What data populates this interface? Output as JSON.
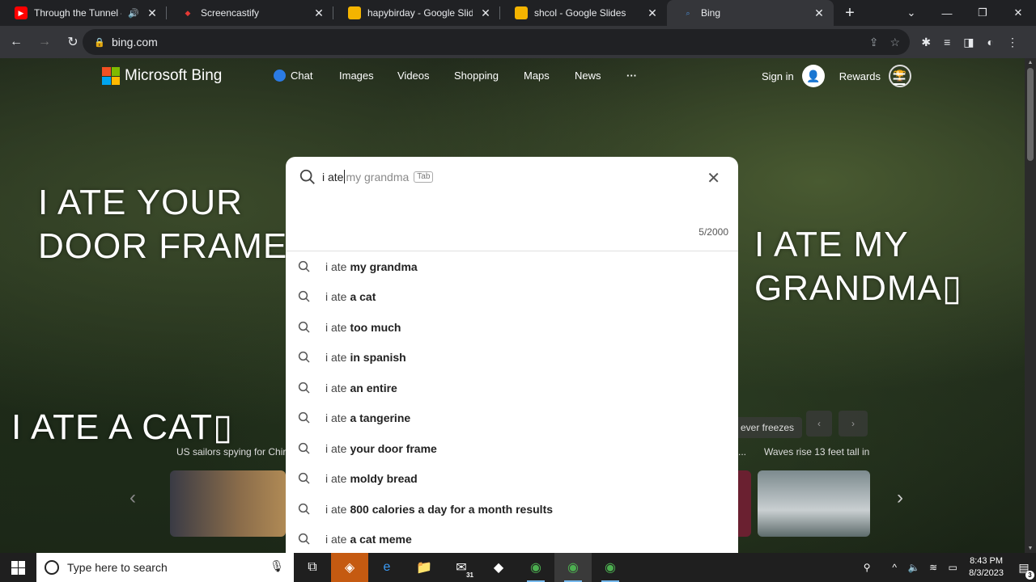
{
  "browser": {
    "tabs": [
      {
        "title": "Through the Tunnel – Ki",
        "favicon": "youtube-icon",
        "audio": true
      },
      {
        "title": "Screencastify",
        "favicon": "screencastify-icon"
      },
      {
        "title": "hapybirday - Google Slides",
        "favicon": "slides-icon"
      },
      {
        "title": "shcol - Google Slides",
        "favicon": "slides-icon"
      },
      {
        "title": "Bing",
        "favicon": "bing-icon",
        "active": true
      }
    ],
    "url": "bing.com"
  },
  "bing": {
    "brand": "Microsoft Bing",
    "nav": [
      "Chat",
      "Images",
      "Videos",
      "Shopping",
      "Maps",
      "News",
      "···"
    ],
    "sign_in": "Sign in",
    "rewards": "Rewards"
  },
  "overlay_text": {
    "left_top_1": "I ATE YOUR",
    "left_top_2": "DOOR FRAME▯",
    "right_1": "I ATE MY",
    "right_2": "GRANDMA▯",
    "left_bottom": "I ATE A CAT▯"
  },
  "news_strip": {
    "left_caption": "US sailors spying for Chir",
    "mid_caption": "ever freezes",
    "right_caption": "Waves rise 13 feet tall in",
    "dots": "..."
  },
  "search": {
    "typed": "i ate",
    "ghost": " my grandma",
    "tab_hint": "Tab",
    "count": "5/2000",
    "prefix": "i ate",
    "suggestions": [
      "my grandma",
      "a cat",
      "too much",
      "in spanish",
      "an entire",
      "a tangerine",
      "your door frame",
      "moldy bread",
      "800 calories a day for a month results",
      "a cat meme"
    ]
  },
  "taskbar": {
    "search_placeholder": "Type here to search",
    "time": "8:43 PM",
    "date": "8/3/2023",
    "notif_count": "3",
    "mail_badge": "31"
  },
  "colors": {
    "bing_chat_blue": "#2b7be4",
    "ms_red": "#f25022",
    "ms_green": "#7fba00",
    "ms_blue": "#00a4ef",
    "ms_yellow": "#ffb900"
  }
}
